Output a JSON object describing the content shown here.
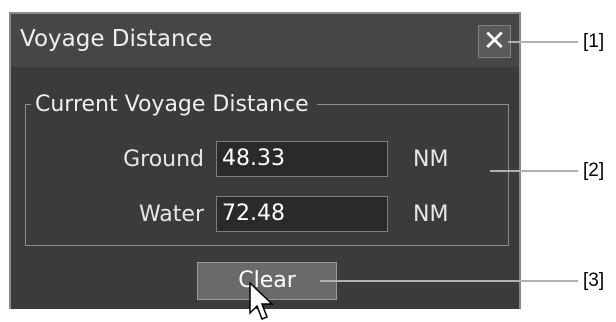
{
  "dialog": {
    "title": "Voyage Distance",
    "close_label": "✕",
    "group_title": "Current Voyage Distance",
    "rows": [
      {
        "label": "Ground",
        "value": "48.33",
        "unit": "NM"
      },
      {
        "label": "Water",
        "value": "72.48",
        "unit": "NM"
      }
    ],
    "clear_label": "Clear"
  },
  "callouts": [
    "[1]",
    "[2]",
    "[3]"
  ],
  "icons": {
    "close": "close-icon",
    "cursor": "mouse-pointer-icon"
  },
  "colors": {
    "dialog_bg": "#3b3b3b",
    "titlebar_bg": "#464646",
    "button_bg": "#6a6a6a"
  }
}
